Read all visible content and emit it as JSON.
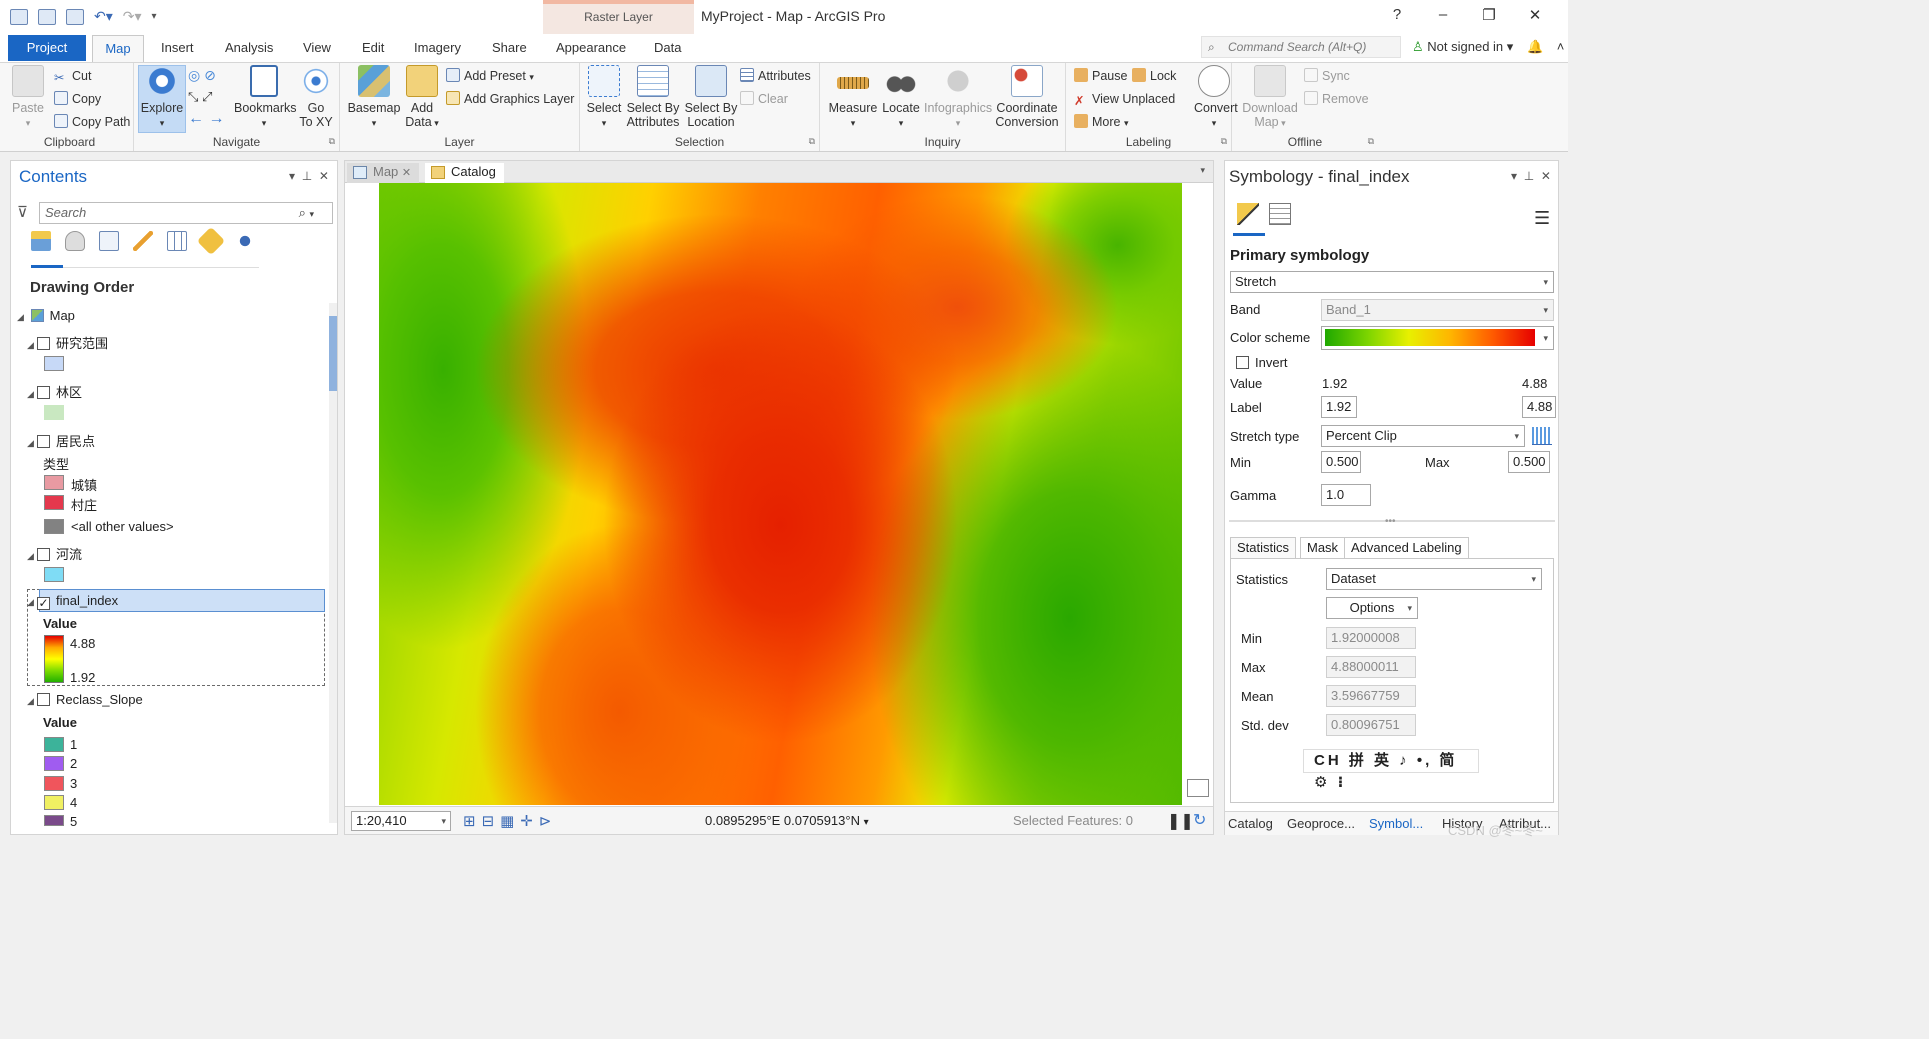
{
  "window": {
    "title": "MyProject - Map - ArcGIS Pro",
    "context_tab_group": "Raster Layer",
    "help": "?",
    "minimize": "–",
    "restore": "❐",
    "close": "✕"
  },
  "quick_access": {
    "icons": [
      "new-project-icon",
      "open-project-icon",
      "save-project-icon",
      "undo-icon",
      "redo-icon",
      "customize-icon"
    ]
  },
  "tabs": {
    "project": "Project",
    "items": [
      "Map",
      "Insert",
      "Analysis",
      "View",
      "Edit",
      "Imagery",
      "Share",
      "Appearance",
      "Data"
    ],
    "active": "Map"
  },
  "command_search": {
    "placeholder": "Command Search (Alt+Q)"
  },
  "account": {
    "label": "Not signed in",
    "caret": "▾",
    "bell": "🔔",
    "collapse": "˄"
  },
  "ribbon": {
    "clipboard": {
      "label": "Clipboard",
      "paste": "Paste",
      "cut": "Cut",
      "copy": "Copy",
      "copy_path": "Copy Path"
    },
    "navigate": {
      "label": "Navigate",
      "explore": "Explore",
      "bookmarks": "Bookmarks",
      "goto": "Go",
      "goto2": "To XY"
    },
    "layer": {
      "label": "Layer",
      "basemap": "Basemap",
      "add_data": "Add",
      "add_data2": "Data",
      "add_preset": "Add Preset",
      "add_graphics": "Add Graphics Layer"
    },
    "selection": {
      "label": "Selection",
      "select": "Select",
      "select_attr": "Select By",
      "select_attr2": "Attributes",
      "select_loc": "Select By",
      "select_loc2": "Location",
      "attributes": "Attributes",
      "clear": "Clear"
    },
    "inquiry": {
      "label": "Inquiry",
      "measure": "Measure",
      "locate": "Locate",
      "infographics": "Infographics",
      "coord": "Coordinate",
      "coord2": "Conversion"
    },
    "labeling": {
      "label": "Labeling",
      "pause": "Pause",
      "lock": "Lock",
      "view_unplaced": "View Unplaced",
      "more": "More",
      "convert": "Convert"
    },
    "offline": {
      "label": "Offline",
      "download": "Download",
      "download2": "Map",
      "sync": "Sync",
      "remove": "Remove"
    }
  },
  "contents": {
    "title": "Contents",
    "search_placeholder": "Search",
    "drawing_order": "Drawing Order",
    "map": "Map",
    "layers": {
      "l1": "研究范围",
      "l2": "林区",
      "l3": "居民点",
      "l3_field": "类型",
      "l3_v1": "城镇",
      "l3_v2": "村庄",
      "l3_v3": "<all other values>",
      "l4": "河流",
      "l5": "final_index",
      "l5_field": "Value",
      "l5_max": "4.88",
      "l5_min": "1.92",
      "l6": "Reclass_Slope",
      "l6_field": "Value",
      "l6_values": [
        "1",
        "2",
        "3",
        "4",
        "5"
      ]
    },
    "colors": {
      "l1": "#c7d9f7",
      "l2": "#c9e8c1",
      "l3_v1": "#e89aa2",
      "l3_v2": "#e4384d",
      "l3_v3": "#828282",
      "l4": "#7fdcf5",
      "l6": [
        "#3cb39a",
        "#a05cf0",
        "#f0555c",
        "#f0f062",
        "#7a4a8a"
      ]
    }
  },
  "map_view": {
    "tab_map": "Map",
    "tab_catalog": "Catalog",
    "scale": "1:20,410",
    "coordinates": "0.0895295°E 0.0705913°N",
    "selected_features": "Selected Features: 0"
  },
  "symbology": {
    "title": "Symbology - final_index",
    "primary": "Primary symbology",
    "renderer": "Stretch",
    "band_label": "Band",
    "band": "Band_1",
    "color_scheme_label": "Color scheme",
    "invert": "Invert",
    "value_label": "Value",
    "value_min": "1.92",
    "value_max": "4.88",
    "label_label": "Label",
    "label_min": "1.92",
    "label_max": "4.88",
    "stretch_type_label": "Stretch type",
    "stretch_type": "Percent Clip",
    "min_label": "Min",
    "min": "0.500",
    "max_label": "Max",
    "max": "0.500",
    "gamma_label": "Gamma",
    "gamma": "1.0",
    "tabs": [
      "Statistics",
      "Mask",
      "Advanced Labeling"
    ],
    "statistics_label": "Statistics",
    "statistics": "Dataset",
    "options": "Options",
    "stat_min_label": "Min",
    "stat_min": "1.92000008",
    "stat_max_label": "Max",
    "stat_max": "4.88000011",
    "stat_mean_label": "Mean",
    "stat_mean": "3.59667759",
    "stat_std_label": "Std. dev",
    "stat_std": "0.80096751",
    "ime": "CH 拼 英 ♪ •, 简 ⚙ ⁝"
  },
  "bottom_tabs": [
    "Catalog",
    "Geoproce...",
    "Symbol...",
    "History",
    "Attribut..."
  ],
  "watermark": "CSDN @冬~冬~"
}
